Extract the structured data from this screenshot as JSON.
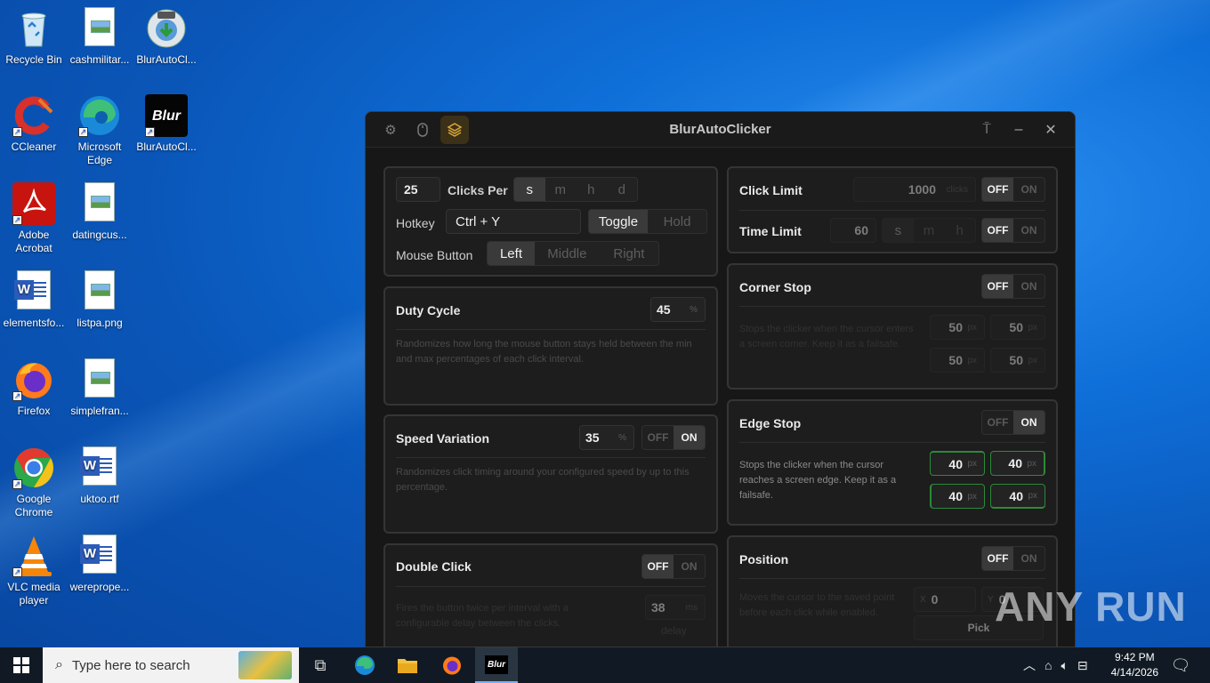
{
  "desktop": {
    "icons": [
      {
        "label": "Recycle Bin",
        "icon": "recycle-bin-icon"
      },
      {
        "label": "cashmilitar...",
        "icon": "image-file-icon"
      },
      {
        "label": "BlurAutoCl...",
        "icon": "installer-icon"
      },
      {
        "label": "CCleaner",
        "icon": "ccleaner-icon"
      },
      {
        "label": "Microsoft Edge",
        "icon": "edge-icon"
      },
      {
        "label": "BlurAutoCl...",
        "icon": "blur-app-icon"
      },
      {
        "label": "Adobe Acrobat",
        "icon": "acrobat-icon"
      },
      {
        "label": "datingcus...",
        "icon": "image-file-icon"
      },
      {
        "label": "elementsfo...",
        "icon": "word-file-icon"
      },
      {
        "label": "listpa.png",
        "icon": "image-file-icon"
      },
      {
        "label": "Firefox",
        "icon": "firefox-icon"
      },
      {
        "label": "simplefran...",
        "icon": "image-file-icon"
      },
      {
        "label": "Google Chrome",
        "icon": "chrome-icon"
      },
      {
        "label": "uktoo.rtf",
        "icon": "word-file-icon"
      },
      {
        "label": "VLC media player",
        "icon": "vlc-icon"
      },
      {
        "label": "wereprope...",
        "icon": "word-file-icon"
      }
    ],
    "blur_logo_text": "Blur"
  },
  "window": {
    "title": "BlurAutoClicker",
    "accent": "#d9a83a"
  },
  "clicks": {
    "value": "25",
    "label": "Clicks Per",
    "units": [
      "s",
      "m",
      "h",
      "d"
    ],
    "selected_unit": "s",
    "hotkey_label": "Hotkey",
    "hotkey_value": "Ctrl + Y",
    "mode_options": [
      "Toggle",
      "Hold"
    ],
    "mode_selected": "Toggle",
    "mouse_label": "Mouse Button",
    "mouse_options": [
      "Left",
      "Middle",
      "Right"
    ],
    "mouse_selected": "Left"
  },
  "duty_cycle": {
    "title": "Duty Cycle",
    "value": "45",
    "unit": "%",
    "desc": "Randomizes how long the mouse button stays held between the min and max percentages of each click interval."
  },
  "speed_variation": {
    "title": "Speed Variation",
    "value": "35",
    "unit": "%",
    "off": "OFF",
    "on": "ON",
    "state": "ON",
    "desc": "Randomizes click timing around your configured speed by up to this percentage."
  },
  "double_click": {
    "title": "Double Click",
    "off": "OFF",
    "on": "ON",
    "state": "OFF",
    "desc": "Fires the button twice per interval with a configurable delay between the clicks.",
    "delay_value": "38",
    "delay_unit": "ms",
    "delay_label": "delay"
  },
  "click_limit": {
    "title": "Click Limit",
    "value": "1000",
    "unit": "clicks",
    "off": "OFF",
    "on": "ON",
    "state": "OFF"
  },
  "time_limit": {
    "title": "Time Limit",
    "value": "60",
    "units": [
      "s",
      "m",
      "h"
    ],
    "off": "OFF",
    "on": "ON",
    "state": "OFF"
  },
  "corner_stop": {
    "title": "Corner Stop",
    "off": "OFF",
    "on": "ON",
    "state": "OFF",
    "desc": "Stops the clicker when the cursor enters a screen corner. Keep it as a failsafe.",
    "values": [
      "50",
      "50",
      "50",
      "50"
    ],
    "unit": "px"
  },
  "edge_stop": {
    "title": "Edge Stop",
    "off": "OFF",
    "on": "ON",
    "state": "ON",
    "desc": "Stops the clicker when the cursor reaches a screen edge. Keep it as a failsafe.",
    "values": [
      "40",
      "40",
      "40",
      "40"
    ],
    "unit": "px",
    "active_color": "#2c8a3a"
  },
  "position": {
    "title": "Position",
    "off": "OFF",
    "on": "ON",
    "state": "OFF",
    "desc": "Moves the cursor to the saved point before each click while enabled.",
    "x_label": "X",
    "x_value": "0",
    "y_label": "Y",
    "y_value": "0",
    "pick_label": "Pick"
  },
  "taskbar": {
    "search_placeholder": "Type here to search",
    "time": "9:42 PM",
    "date": "4/14/2026",
    "blur_label": "Blur"
  },
  "watermark": "ANY RUN"
}
